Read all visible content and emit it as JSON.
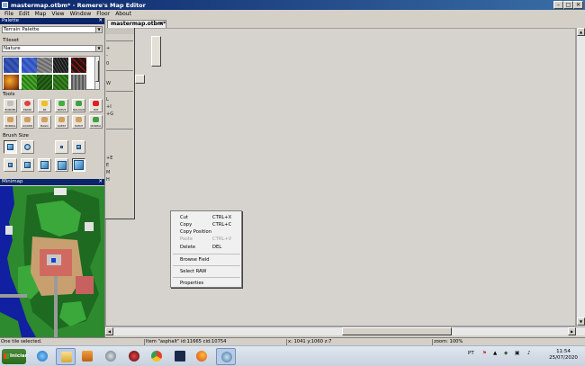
{
  "window": {
    "title": "mastermap.otbm* - Remere's Map Editor",
    "controls": [
      "–",
      "□",
      "✕"
    ]
  },
  "menu": [
    "File",
    "Edit",
    "Map",
    "View",
    "Window",
    "Floor",
    "About"
  ],
  "palette": {
    "title": "Palette",
    "close": "✕",
    "type_value": "Terrain Palette",
    "tileset_label": "Tileset",
    "tileset_value": "Nature",
    "tools_label": "Tools",
    "tools": [
      [
        "BORDER",
        "#c0c0c0"
      ],
      [
        "ERASE",
        "#e04040"
      ],
      [
        "PZ",
        "#f0c020"
      ],
      [
        "NOPVP",
        "#40b040"
      ],
      [
        "NOLOGOUT",
        "#40a040"
      ],
      [
        "PVP",
        "#e02020"
      ],
      [
        "NORMAL",
        "#d0a060"
      ],
      [
        "LOCKED",
        "#d0a060"
      ],
      [
        "MAGIC",
        "#d0a060"
      ],
      [
        "QUEST",
        "#d0a060"
      ],
      [
        "HATCH",
        "#d0a060"
      ],
      [
        "NORMAL",
        "#40a040"
      ]
    ],
    "brush_size_label": "Brush Size"
  },
  "minimap": {
    "title": "Minimap",
    "close": "✕"
  },
  "tab": {
    "label": "mastermap.otbm*",
    "close": "✕"
  },
  "side_keys": [
    "+",
    "-",
    "0",
    "W",
    "L",
    "+I",
    "+G",
    "+E",
    "E",
    "M",
    "H"
  ],
  "context_menu": {
    "items": [
      {
        "label": "Cut",
        "shortcut": "CTRL+X",
        "disabled": false
      },
      {
        "label": "Copy",
        "shortcut": "CTRL+C",
        "disabled": false
      },
      {
        "label": "Copy Position",
        "shortcut": "",
        "disabled": false
      },
      {
        "label": "Paste",
        "shortcut": "CTRL+V",
        "disabled": true
      },
      {
        "label": "Delete",
        "shortcut": "DEL",
        "disabled": false
      }
    ],
    "browse": "Browse Field",
    "select_raw": "Select RAW",
    "properties": "Properties"
  },
  "status": {
    "message": "One tile selected.",
    "item": "Item \"asphalt\" id:11665 cid:10754",
    "coords": "x: 1041 y:1060 z:7",
    "zoom": "zoom: 100%"
  },
  "taskbar": {
    "start": "Iniciar",
    "lang": "PT",
    "time": "11:54",
    "date": "25/07/2020"
  }
}
